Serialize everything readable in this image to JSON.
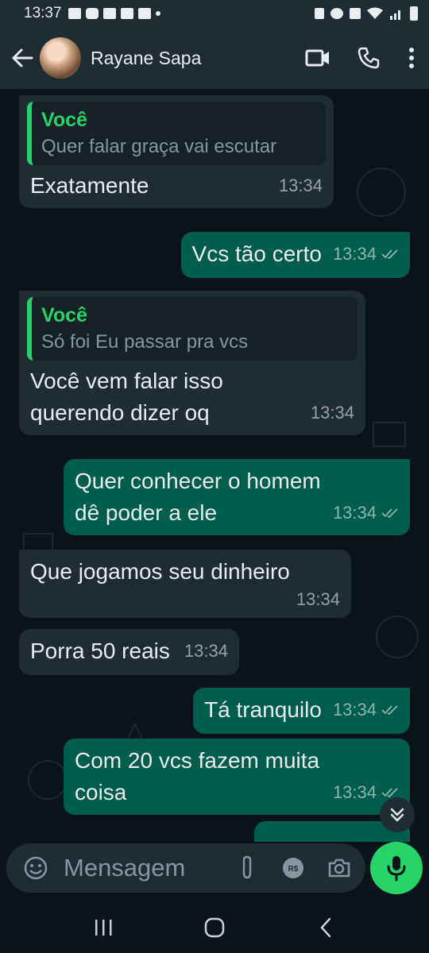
{
  "status_bar": {
    "time": "13:37"
  },
  "header": {
    "contact_name": "Rayane Sapa"
  },
  "messages": [
    {
      "dir": "in",
      "quote_author": "Você",
      "quote_text": "Quer falar graça vai escutar",
      "text": "Exatamente",
      "time": "13:34"
    },
    {
      "dir": "out",
      "text": "Vcs tão certo",
      "time": "13:34"
    },
    {
      "dir": "in",
      "quote_author": "Você",
      "quote_text": "Só foi Eu passar pra vcs",
      "text_line1": "Você vem falar isso",
      "text_line2": "querendo dizer oq",
      "time": "13:34"
    },
    {
      "dir": "out",
      "text_line1": "Quer conhecer o homem",
      "text_line2": "dê poder a ele",
      "time": "13:34"
    },
    {
      "dir": "in",
      "text": "Que jogamos seu dinheiro",
      "time": "13:34"
    },
    {
      "dir": "in",
      "text": "Porra 50 reais",
      "time": "13:34"
    },
    {
      "dir": "out",
      "text": "Tá tranquilo",
      "time": "13:34"
    },
    {
      "dir": "out",
      "text_line1": "Com 20 vcs fazem muita",
      "text_line2": "coisa",
      "time": "13:34"
    }
  ],
  "composer": {
    "placeholder": "Mensagem"
  },
  "colors": {
    "accent": "#25d366",
    "outgoing_bubble": "#005c4b",
    "incoming_bubble": "#1f2c34",
    "background": "#0b141a"
  },
  "icons": [
    "back-arrow-icon",
    "video-call-icon",
    "phone-icon",
    "more-icon",
    "emoji-icon",
    "attach-icon",
    "payment-icon",
    "camera-icon",
    "mic-icon",
    "scroll-down-icon",
    "double-check-icon"
  ]
}
